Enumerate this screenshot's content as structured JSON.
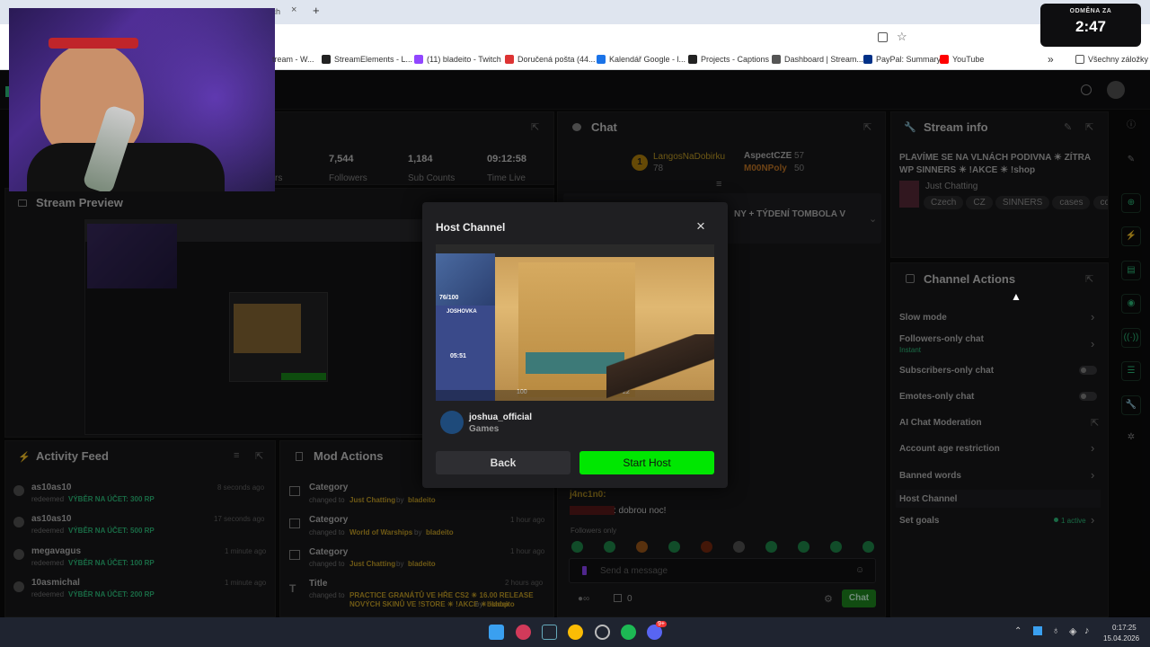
{
  "browser": {
    "new_tab": "+",
    "tab_partial": "tch",
    "bookmarks": [
      {
        "label": "tream - W...",
        "color": "#e33"
      },
      {
        "label": "StreamElements - L...",
        "color": "#222"
      },
      {
        "label": "(11) bladeito - Twitch",
        "color": "#9146ff"
      },
      {
        "label": "Doručená pošta (44...",
        "color": "#d33"
      },
      {
        "label": "Kalendář Google - l...",
        "color": "#1a73e8"
      },
      {
        "label": "Projects - Captions",
        "color": "#222"
      },
      {
        "label": "Dashboard | Stream...",
        "color": "#555"
      },
      {
        "label": "PayPal: Summary",
        "color": "#003087"
      },
      {
        "label": "YouTube",
        "color": "#f00"
      }
    ],
    "more": "»",
    "all_bookmarks": "Všechny záložky"
  },
  "countdown": {
    "label": "ODMĚNA ZA",
    "value": "2:47"
  },
  "stats": {
    "partial": "rs",
    "items": [
      {
        "value": "7,544",
        "label": "Followers"
      },
      {
        "value": "1,184",
        "label": "Sub Counts"
      },
      {
        "value": "09:12:58",
        "label": "Time Live"
      }
    ]
  },
  "stream_preview": {
    "title": "Stream Preview"
  },
  "chat": {
    "title": "Chat",
    "leaders": [
      {
        "name": "LangosNaDobirku",
        "points": "78",
        "rank": "1"
      },
      {
        "name": "AspectCZE",
        "points": "57"
      },
      {
        "name": "M00NPoly",
        "points": "50"
      }
    ],
    "pinned_partial": "NY + TÝDENÍ TOMBOLA V",
    "msg_user": "j4nc1n0:",
    "msg_user2": "",
    "msg_text": ": dobrou noc!",
    "followers_only": "Followers only",
    "placeholder": "Send a message",
    "count": "0",
    "send": "Chat"
  },
  "stream_info": {
    "title": "Stream info",
    "stream_title": "PLAVÍME SE NA VLNÁCH PODIVNA ☀ ZÍTRA WP SINNERS ☀ !AKCE ☀ !shop",
    "category": "Just Chatting",
    "tags": [
      "Czech",
      "CZ",
      "SINNERS",
      "cases",
      "cou"
    ]
  },
  "channel_actions": {
    "title": "Channel Actions",
    "items": [
      {
        "label": "Slow mode",
        "sub": ""
      },
      {
        "label": "Followers-only chat",
        "sub": "Instant"
      },
      {
        "label": "Subscribers-only chat",
        "sub": ""
      },
      {
        "label": "Emotes-only chat",
        "sub": ""
      },
      {
        "label": "AI Chat Moderation",
        "sub": ""
      },
      {
        "label": "Account age restriction",
        "sub": ""
      },
      {
        "label": "Banned words",
        "sub": ""
      },
      {
        "label": "Host Channel",
        "sub": ""
      },
      {
        "label": "Set goals",
        "sub": "1 active"
      }
    ]
  },
  "activity": {
    "title": "Activity Feed",
    "items": [
      {
        "user": "as10as10",
        "action": "redeemed",
        "reward": "VÝBĚR NA ÚČET: 300 RP",
        "time": "8 seconds ago"
      },
      {
        "user": "as10as10",
        "action": "redeemed",
        "reward": "VÝBĚR NA ÚČET: 500 RP",
        "time": "17 seconds ago"
      },
      {
        "user": "megavagus",
        "action": "redeemed",
        "reward": "VÝBĚR NA ÚČET: 100 RP",
        "time": "1 minute ago"
      },
      {
        "user": "10asmichal",
        "action": "redeemed",
        "reward": "VÝBĚR NA ÚČET: 200 RP",
        "time": "1 minute ago"
      }
    ]
  },
  "mod_actions": {
    "title": "Mod Actions",
    "items": [
      {
        "type": "Category",
        "pre": "changed to",
        "value": "Just Chatting",
        "by": "by",
        "user": "bladeito",
        "time": ""
      },
      {
        "type": "Category",
        "pre": "changed to",
        "value": "World of Warships",
        "by": "by",
        "user": "bladeito",
        "time": "1 hour ago"
      },
      {
        "type": "Category",
        "pre": "changed to",
        "value": "Just Chatting",
        "by": "by",
        "user": "bladeito",
        "time": "1 hour ago"
      },
      {
        "type": "Title",
        "pre": "changed to",
        "value": "PRACTICE GRANÁTŮ VE HŘE CS2 ☀ 16.00 RELEASE NOVÝCH SKINŮ VE !STORE ☀ !AKCE ☀ !shop",
        "by": "by",
        "user": "bladeito",
        "time": "2 hours ago"
      }
    ]
  },
  "modal": {
    "title": "Host Channel",
    "close": "×",
    "channel": "joshua_official",
    "category": "Games",
    "back": "Back",
    "start": "Start Host",
    "hud": {
      "hp": "76/100",
      "name": "JOSHOVKA",
      "timer": "05:51",
      "money": "100",
      "ammo": "22"
    }
  },
  "taskbar": {
    "time": "0:17:25",
    "date": "15.04.2026",
    "discord_badge": "9+"
  },
  "colors": {
    "accent": "#00e701",
    "link": "#2ec27e",
    "panel": "#18181a"
  }
}
